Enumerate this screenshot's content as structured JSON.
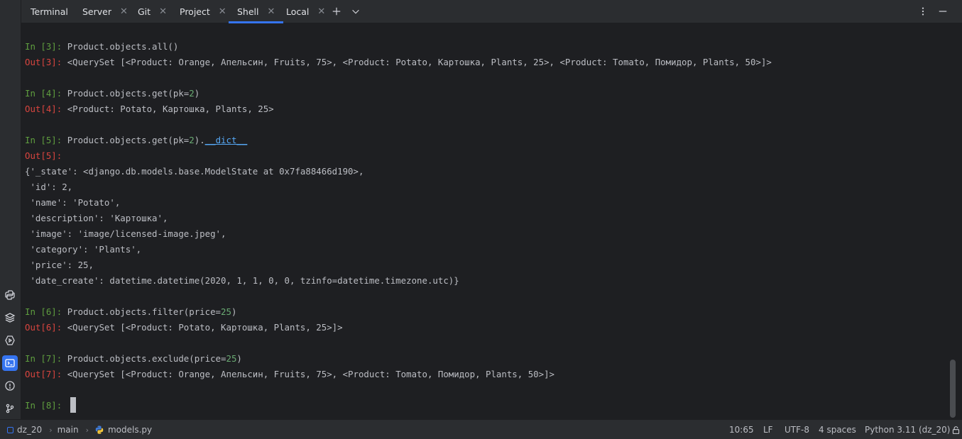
{
  "toolwindow": {
    "title": "Terminal"
  },
  "tabs": [
    {
      "label": "Server",
      "closable": true
    },
    {
      "label": "Git",
      "closable": true
    },
    {
      "label": "Project",
      "closable": true
    },
    {
      "label": "Shell",
      "closable": true,
      "active": true
    },
    {
      "label": "Local",
      "closable": true
    }
  ],
  "tab_close_glyph": "✕",
  "console": {
    "in3_prompt": "In [3]: ",
    "in3_code": "Product.objects.all()",
    "out3_prompt": "Out[3]: ",
    "out3_text": "<QuerySet [<Product: Orange, Апельсин, Fruits, 75>, <Product: Potato, Картошка, Plants, 25>, <Product: Tomato, Помидор, Plants, 50>]>",
    "in4_prompt": "In [4]: ",
    "in4_code_a": "Product.objects.get(pk=",
    "in4_num": "2",
    "in4_code_b": ")",
    "out4_prompt": "Out[4]: ",
    "out4_text": "<Product: Potato, Картошка, Plants, 25>",
    "in5_prompt": "In [5]: ",
    "in5_code_a": "Product.objects.get(pk=",
    "in5_num": "2",
    "in5_code_b": ").",
    "in5_dunder": "__dict__",
    "out5_prompt": "Out[5]:",
    "dict_lines": [
      "{'_state': <django.db.models.base.ModelState at 0x7fa88466d190>,",
      " 'id': 2,",
      " 'name': 'Potato',",
      " 'description': 'Картошка',",
      " 'image': 'image/licensed-image.jpeg',",
      " 'category': 'Plants',",
      " 'price': 25,",
      " 'date_create': datetime.datetime(2020, 1, 1, 0, 0, tzinfo=datetime.timezone.utc)}"
    ],
    "in6_prompt": "In [6]: ",
    "in6_code_a": "Product.objects.filter(price=",
    "in6_num": "25",
    "in6_code_b": ")",
    "out6_prompt": "Out[6]: ",
    "out6_text": "<QuerySet [<Product: Potato, Картошка, Plants, 25>]>",
    "in7_prompt": "In [7]: ",
    "in7_code_a": "Product.objects.exclude(price=",
    "in7_num": "25",
    "in7_code_b": ")",
    "out7_prompt": "Out[7]: ",
    "out7_text": "<QuerySet [<Product: Orange, Апельсин, Fruits, 75>, <Product: Tomato, Помидор, Plants, 50>]>",
    "in8_prompt": "In [8]: "
  },
  "statusbar": {
    "project": "dz_20",
    "branch": "main",
    "file": "models.py",
    "position": "10:65",
    "line_sep": "LF",
    "encoding": "UTF-8",
    "indent": "4 spaces",
    "interpreter": "Python 3.11 (dz_20)",
    "crumb_sep": "›"
  },
  "colors": {
    "accent": "#3574f0",
    "in_prompt": "#5f9e3f",
    "out_prompt": "#d9453f",
    "number": "#6aab73",
    "dunder": "#56a8f5"
  }
}
